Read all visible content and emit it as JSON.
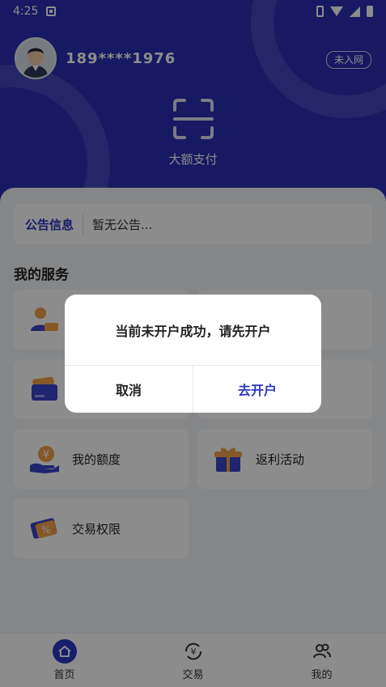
{
  "status_bar": {
    "time": "4:25"
  },
  "header": {
    "phone": "189****1976",
    "badge": "未入网",
    "scan_label": "大额支付"
  },
  "notice": {
    "title": "公告信息",
    "text": "暂无公告..."
  },
  "services": {
    "title": "我的服务",
    "items": [
      {
        "label": "",
        "icon": "user-card-icon"
      },
      {
        "label": "",
        "icon": "service-icon"
      },
      {
        "label": "",
        "icon": "wallet-card-icon"
      },
      {
        "label": "",
        "icon": "service-icon"
      },
      {
        "label": "我的额度",
        "icon": "hand-coin-icon"
      },
      {
        "label": "返利活动",
        "icon": "gift-icon"
      },
      {
        "label": "交易权限",
        "icon": "ticket-percent-icon"
      }
    ]
  },
  "tabbar": {
    "tabs": [
      {
        "label": "首页",
        "icon": "home-icon",
        "active": true
      },
      {
        "label": "交易",
        "icon": "yen-exchange-icon",
        "active": false
      },
      {
        "label": "我的",
        "icon": "users-icon",
        "active": false
      }
    ]
  },
  "dialog": {
    "message": "当前未开户成功，请先开户",
    "cancel_label": "取消",
    "confirm_label": "去开户"
  },
  "colors": {
    "brand": "#2a2fb3",
    "accent": "#3038c0",
    "icon_orange": "#f2a04a"
  }
}
